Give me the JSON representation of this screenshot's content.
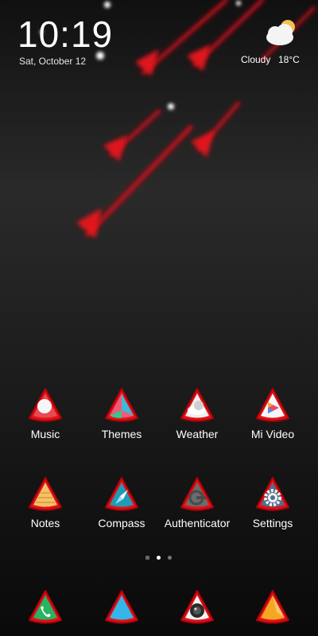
{
  "status": {
    "time": "10:19",
    "date": "Sat, October 12",
    "weather": {
      "condition": "Cloudy",
      "temperature": "18°C",
      "icon": "cloud-sun-icon"
    }
  },
  "apps": [
    {
      "label": "Music",
      "icon": "music-icon"
    },
    {
      "label": "Themes",
      "icon": "themes-icon"
    },
    {
      "label": "Weather",
      "icon": "weather-icon"
    },
    {
      "label": "Mi Video",
      "icon": "video-play-icon"
    },
    {
      "label": "Notes",
      "icon": "notes-icon"
    },
    {
      "label": "Compass",
      "icon": "compass-icon"
    },
    {
      "label": "Authenticator",
      "icon": "authenticator-icon"
    },
    {
      "label": "Settings",
      "icon": "gear-icon"
    }
  ],
  "dock": [
    {
      "icon": "phone-icon"
    },
    {
      "icon": "messages-icon"
    },
    {
      "icon": "camera-icon"
    },
    {
      "icon": "browser-icon"
    }
  ],
  "page_indicator": {
    "pages": 3,
    "current": 2
  },
  "colors": {
    "accent_red": "#e0141c",
    "background": "#1c1c1c"
  }
}
